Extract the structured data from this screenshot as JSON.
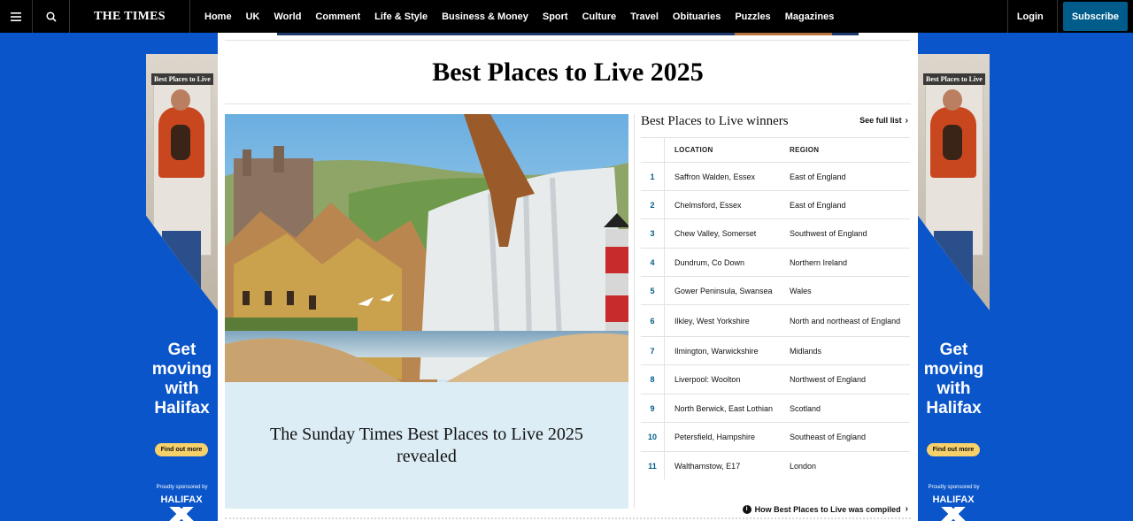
{
  "nav": {
    "menu_icon": "hamburger-icon",
    "search_icon": "search-icon",
    "logo": "THE TIMES",
    "links": [
      "Home",
      "UK",
      "World",
      "Comment",
      "Life & Style",
      "Business & Money",
      "Sport",
      "Culture",
      "Travel",
      "Obituaries",
      "Puzzles",
      "Magazines"
    ],
    "login": "Login",
    "subscribe": "Subscribe",
    "subscribe_color": "#005c8a"
  },
  "ad": {
    "sign": "Best Places to Live",
    "headline": "Get moving with Halifax",
    "cta": "Find out more",
    "sponsor": "Proudly sponsored by",
    "brand": "HALIFAX",
    "bg_color": "#0a55c9"
  },
  "page": {
    "title": "Best Places to Live 2025"
  },
  "hero": {
    "caption": "The Sunday Times Best Places to Live 2025 revealed",
    "caption_bg": "#dcedf5"
  },
  "winners": {
    "title": "Best Places to Live winners",
    "see_full_list": "See full list",
    "col_location": "LOCATION",
    "col_region": "REGION",
    "rows": [
      {
        "rank": "1",
        "location": "Saffron Walden, Essex",
        "region": "East of England"
      },
      {
        "rank": "2",
        "location": "Chelmsford, Essex",
        "region": "East of England"
      },
      {
        "rank": "3",
        "location": "Chew Valley, Somerset",
        "region": "Southwest of England"
      },
      {
        "rank": "4",
        "location": "Dundrum, Co Down",
        "region": "Northern Ireland"
      },
      {
        "rank": "5",
        "location": "Gower Peninsula, Swansea",
        "region": "Wales"
      },
      {
        "rank": "6",
        "location": "Ilkley, West Yorkshire",
        "region": "North and northeast of England"
      },
      {
        "rank": "7",
        "location": "Ilmington, Warwickshire",
        "region": "Midlands"
      },
      {
        "rank": "8",
        "location": "Liverpool: Woolton",
        "region": "Northwest of England"
      },
      {
        "rank": "9",
        "location": "North Berwick, East Lothian",
        "region": "Scotland"
      },
      {
        "rank": "10",
        "location": "Petersfield, Hampshire",
        "region": "Southeast of England"
      },
      {
        "rank": "11",
        "location": "Walthamstow, E17",
        "region": "London"
      }
    ],
    "methodology": "How Best Places to Live was compiled",
    "rank_color": "#005c8a"
  }
}
